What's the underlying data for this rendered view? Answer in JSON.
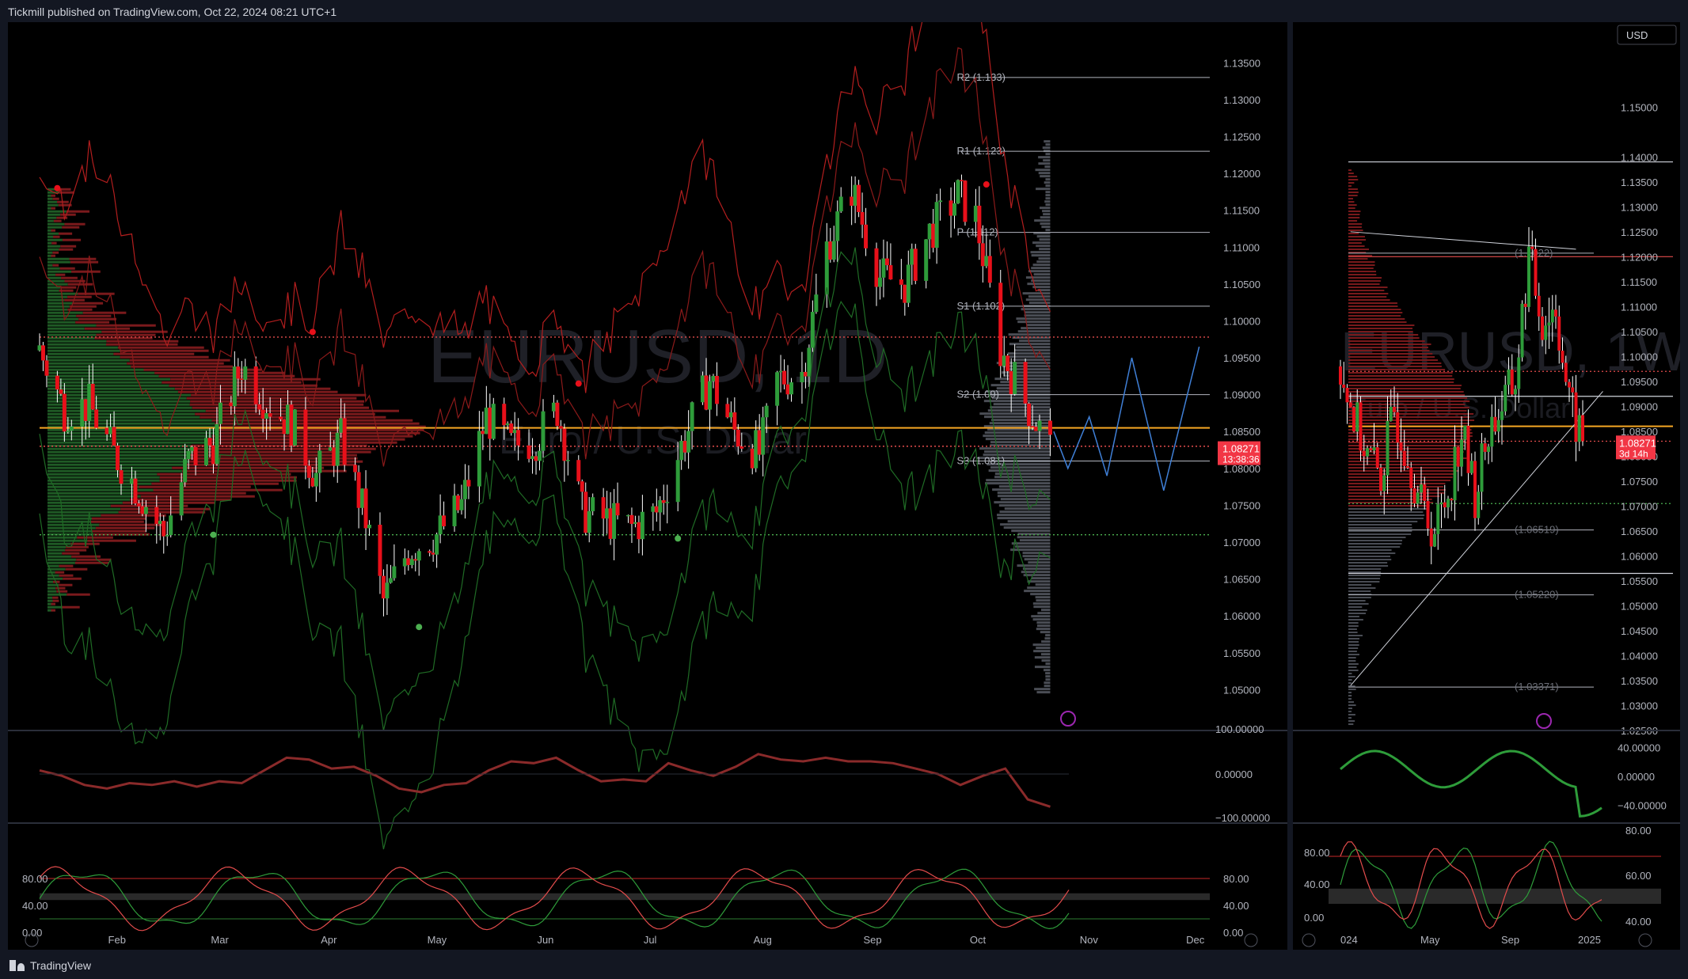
{
  "header": {
    "published": "Tickmill published on TradingView.com, Oct 22, 2024 08:21 UTC+1"
  },
  "footer": {
    "brand": "TradingView"
  },
  "colors": {
    "bg": "#000000",
    "frame": "#131722",
    "bull": "#2e9c3a",
    "bear": "#e8101a",
    "pivot": "#b2b5be",
    "poc": "#f5a623",
    "red_dotted": "#e34c4c",
    "green_dotted": "#4caf50",
    "projection": "#3f7fd6"
  },
  "left": {
    "watermark_symbol": "EURUSD, 1D",
    "watermark_name": "Euro / U.S. Dollar",
    "last_price": "1.08271",
    "countdown": "13:38:36",
    "icon": "lightning-icon"
  },
  "right": {
    "watermark_symbol": "EURUSD, 1W",
    "watermark_name": "Euro / U.S. Dollar",
    "currency": "USD",
    "last_price": "1.08271",
    "countdown": "3d 14h",
    "icon": "lightning-icon"
  },
  "chart_data": [
    {
      "type": "candlestick",
      "panel": "left-main",
      "timeframe": "1D",
      "x_range": [
        "2024-01-10",
        "2024-12-05"
      ],
      "ylim": [
        1.045,
        1.1375
      ],
      "y_ticks": [
        "1.13500",
        "1.13000",
        "1.12500",
        "1.12000",
        "1.11500",
        "1.11000",
        "1.10500",
        "1.10000",
        "1.09500",
        "1.09000",
        "1.08500",
        "1.08000",
        "1.07500",
        "1.07000",
        "1.06500",
        "1.06000",
        "1.05500",
        "1.05000"
      ],
      "x_ticks": [
        "Feb",
        "Mar",
        "Apr",
        "May",
        "Jun",
        "Jul",
        "Aug",
        "Sep",
        "Oct",
        "Nov",
        "Dec"
      ],
      "close_path": [
        [
          "2024-01-10",
          1.096
        ],
        [
          "2024-01-17",
          1.088
        ],
        [
          "2024-01-24",
          1.0885
        ],
        [
          "2024-01-31",
          1.082
        ],
        [
          "2024-02-07",
          1.077
        ],
        [
          "2024-02-14",
          1.071
        ],
        [
          "2024-02-21",
          1.081
        ],
        [
          "2024-02-28",
          1.0835
        ],
        [
          "2024-03-07",
          1.094
        ],
        [
          "2024-03-14",
          1.089
        ],
        [
          "2024-03-21",
          1.086
        ],
        [
          "2024-03-28",
          1.079
        ],
        [
          "2024-04-04",
          1.084
        ],
        [
          "2024-04-11",
          1.073
        ],
        [
          "2024-04-16",
          1.062
        ],
        [
          "2024-04-23",
          1.069
        ],
        [
          "2024-05-01",
          1.071
        ],
        [
          "2024-05-08",
          1.075
        ],
        [
          "2024-05-15",
          1.087
        ],
        [
          "2024-05-22",
          1.083
        ],
        [
          "2024-05-29",
          1.084
        ],
        [
          "2024-06-04",
          1.088
        ],
        [
          "2024-06-11",
          1.074
        ],
        [
          "2024-06-18",
          1.073
        ],
        [
          "2024-06-25",
          1.072
        ],
        [
          "2024-07-02",
          1.074
        ],
        [
          "2024-07-09",
          1.083
        ],
        [
          "2024-07-17",
          1.092
        ],
        [
          "2024-07-24",
          1.085
        ],
        [
          "2024-07-31",
          1.082
        ],
        [
          "2024-08-05",
          1.092
        ],
        [
          "2024-08-12",
          1.093
        ],
        [
          "2024-08-19",
          1.11
        ],
        [
          "2024-08-26",
          1.118
        ],
        [
          "2024-09-03",
          1.106
        ],
        [
          "2024-09-10",
          1.105
        ],
        [
          "2024-09-17",
          1.112
        ],
        [
          "2024-09-25",
          1.117
        ],
        [
          "2024-09-30",
          1.114
        ],
        [
          "2024-10-07",
          1.096
        ],
        [
          "2024-10-14",
          1.089
        ],
        [
          "2024-10-21",
          1.0827
        ]
      ],
      "pivots": [
        {
          "label": "R2 (1.133)",
          "value": 1.133
        },
        {
          "label": "R1 (1.123)",
          "value": 1.123
        },
        {
          "label": "P (1.112)",
          "value": 1.112
        },
        {
          "label": "S1 (1.102)",
          "value": 1.102
        },
        {
          "label": "S2 (1.09)",
          "value": 1.09
        },
        {
          "label": "S3 (1.081)",
          "value": 1.081
        }
      ],
      "horizontal_lines": [
        {
          "value": 1.0978,
          "style": "red-dotted"
        },
        {
          "value": 1.0855,
          "style": "orange-solid"
        },
        {
          "value": 1.083,
          "style": "red-dotted"
        },
        {
          "value": 1.071,
          "style": "green-dotted"
        }
      ],
      "projection": [
        [
          "2024-10-22",
          1.085
        ],
        [
          "2024-10-26",
          1.08
        ],
        [
          "2024-11-01",
          1.087
        ],
        [
          "2024-11-06",
          1.079
        ],
        [
          "2024-11-13",
          1.095
        ],
        [
          "2024-11-22",
          1.077
        ],
        [
          "2024-12-02",
          1.0965
        ]
      ]
    },
    {
      "type": "line",
      "panel": "left-indicator-1",
      "ylim": [
        -120,
        120
      ],
      "y_ticks": [
        "100.00000",
        "0.00000",
        "−100.00000"
      ],
      "values": [
        10,
        -5,
        -30,
        -40,
        -25,
        -30,
        -20,
        -35,
        -20,
        -25,
        10,
        45,
        40,
        15,
        20,
        -5,
        -40,
        -50,
        -30,
        -25,
        10,
        35,
        30,
        45,
        10,
        -20,
        -15,
        -20,
        30,
        10,
        -5,
        20,
        55,
        40,
        35,
        45,
        35,
        35,
        30,
        15,
        0,
        -30,
        -5,
        15,
        -70,
        -90
      ]
    },
    {
      "type": "line",
      "panel": "left-indicator-2",
      "ylim": [
        -5,
        105
      ],
      "y_ticks": [
        "80.00",
        "40.00",
        "0.00"
      ],
      "bands": [
        80,
        60,
        20
      ]
    },
    {
      "type": "candlestick",
      "panel": "right-main",
      "timeframe": "1W",
      "ylim": [
        1.025,
        1.1575
      ],
      "y_ticks": [
        "1.15000",
        "1.14000",
        "1.13500",
        "1.13000",
        "1.12500",
        "1.12000",
        "1.11500",
        "1.11000",
        "1.10500",
        "1.10000",
        "1.09500",
        "1.09000",
        "1.08500",
        "1.08000",
        "1.07500",
        "1.07000",
        "1.06500",
        "1.06000",
        "1.05500",
        "1.05000",
        "1.04500",
        "1.04000",
        "1.03500",
        "1.03000",
        "1.02500"
      ],
      "x_ticks": [
        "024",
        "May",
        "Sep",
        "2025"
      ],
      "close_path": [
        [
          0,
          1.098
        ],
        [
          4,
          1.088
        ],
        [
          8,
          1.08
        ],
        [
          12,
          1.076
        ],
        [
          16,
          1.089
        ],
        [
          20,
          1.081
        ],
        [
          24,
          1.07
        ],
        [
          28,
          1.065
        ],
        [
          32,
          1.073
        ],
        [
          36,
          1.085
        ],
        [
          40,
          1.072
        ],
        [
          44,
          1.085
        ],
        [
          48,
          1.09
        ],
        [
          52,
          1.095
        ],
        [
          56,
          1.12
        ],
        [
          60,
          1.107
        ],
        [
          64,
          1.11
        ],
        [
          68,
          1.09
        ],
        [
          72,
          1.0827
        ]
      ],
      "levels": [
        {
          "label": "(1.1022)",
          "value": 1.1207
        },
        {
          "label": "(1.06519)",
          "value": 1.0652
        },
        {
          "label": "(1.05220)",
          "value": 1.0522
        },
        {
          "label": "(1.03371)",
          "value": 1.0337
        }
      ],
      "horizontal_lines": [
        {
          "value": 1.139,
          "style": "white"
        },
        {
          "value": 1.12,
          "style": "red"
        },
        {
          "value": 1.097,
          "style": "red-dotted"
        },
        {
          "value": 1.092,
          "style": "white"
        },
        {
          "value": 1.086,
          "style": "orange-solid"
        },
        {
          "value": 1.083,
          "style": "red-dotted"
        },
        {
          "value": 1.0705,
          "style": "green-dotted"
        },
        {
          "value": 1.0565,
          "style": "white"
        }
      ]
    },
    {
      "type": "line",
      "panel": "right-indicator-1",
      "ylim": [
        -60,
        60
      ],
      "y_ticks": [
        "40.00000",
        "0.00000",
        "−40.00000"
      ]
    },
    {
      "type": "line",
      "panel": "right-indicator-2",
      "ylim": [
        35,
        85
      ],
      "y_ticks": [
        "80.00",
        "60.00",
        "40.00"
      ],
      "left_ticks": [
        "80.00",
        "40.00",
        "0.00"
      ]
    }
  ]
}
